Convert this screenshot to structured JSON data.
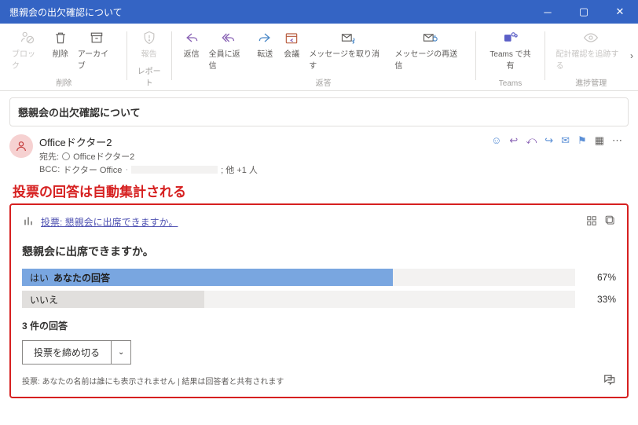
{
  "title": "懇親会の出欠確認について",
  "ribbon": {
    "groups": [
      {
        "label": "削除",
        "items": [
          {
            "id": "block",
            "label": "ブロック",
            "disabled": true
          },
          {
            "id": "delete",
            "label": "削除"
          },
          {
            "id": "archive",
            "label": "アーカイブ"
          }
        ]
      },
      {
        "label": "レポート",
        "items": [
          {
            "id": "report",
            "label": "報告",
            "disabled": true
          }
        ]
      },
      {
        "label": "返答",
        "items": [
          {
            "id": "reply",
            "label": "返信"
          },
          {
            "id": "reply-all",
            "label": "全員に返信"
          },
          {
            "id": "forward",
            "label": "転送"
          },
          {
            "id": "meeting",
            "label": "会議"
          },
          {
            "id": "recall",
            "label": "メッセージを取り消す"
          },
          {
            "id": "resend",
            "label": "メッセージの再送信"
          }
        ]
      },
      {
        "label": "Teams",
        "items": [
          {
            "id": "teams-share",
            "label": "Teams で共有"
          }
        ]
      },
      {
        "label": "進捗管理",
        "items": [
          {
            "id": "track",
            "label": "配計確認を追跡する",
            "disabled": true
          }
        ]
      }
    ]
  },
  "subject": "懇親会の出欠確認について",
  "header": {
    "from": "Officeドクター2",
    "to_prefix": "宛先:",
    "to": "Officeドクター2",
    "bcc_prefix": "BCC:",
    "bcc": "ドクター Office",
    "others": "; 他 +1 人"
  },
  "annotation": "投票の回答は自動集計される",
  "poll": {
    "link_label": "投票: 懇親会に出席できますか。",
    "question": "懇親会に出席できますか。",
    "options": [
      {
        "label": "はい",
        "your_answer": "あなたの回答",
        "pct": 67,
        "selected": true
      },
      {
        "label": "いいえ",
        "your_answer": "",
        "pct": 33,
        "selected": false
      }
    ],
    "count_text": "3 件の回答",
    "close_label": "投票を締め切る",
    "footer": "投票: あなたの名前は誰にも表示されません | 結果は回答者と共有されます"
  },
  "chart_data": {
    "type": "bar",
    "categories": [
      "はい",
      "いいえ"
    ],
    "values": [
      67,
      33
    ],
    "title": "懇親会に出席できますか。",
    "xlabel": "",
    "ylabel": "%",
    "ylim": [
      0,
      100
    ]
  }
}
